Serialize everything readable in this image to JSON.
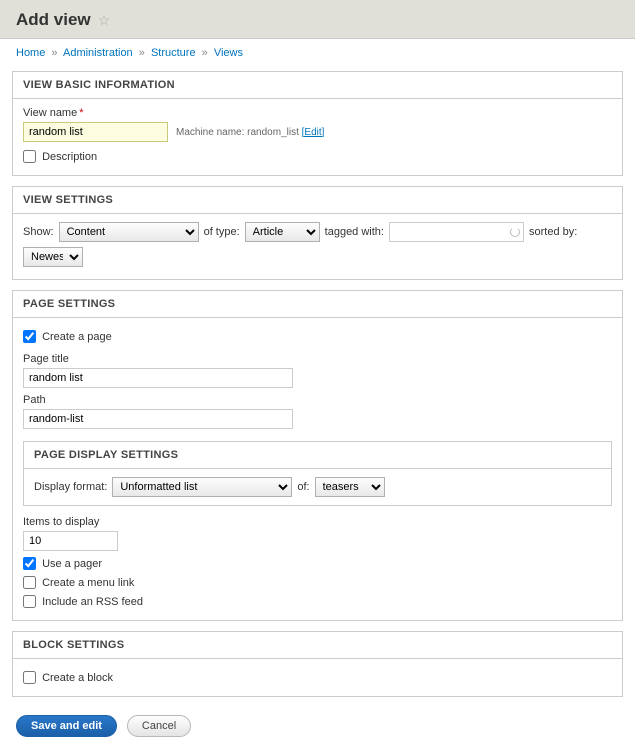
{
  "header": {
    "title": "Add view"
  },
  "breadcrumb": {
    "home": "Home",
    "admin": "Administration",
    "structure": "Structure",
    "views": "Views"
  },
  "basic": {
    "heading": "VIEW BASIC INFORMATION",
    "viewname_label": "View name",
    "viewname_value": "random list",
    "machine_label": "Machine name:",
    "machine_value": "random_list",
    "edit_label": "[Edit]",
    "description_label": "Description"
  },
  "settings": {
    "heading": "VIEW SETTINGS",
    "show_label": "Show:",
    "show_value": "Content",
    "of_type_label": "of type:",
    "of_type_value": "Article",
    "tagged_label": "tagged with:",
    "tagged_value": "",
    "sorted_label": "sorted by:",
    "sorted_value": "Newest first"
  },
  "page": {
    "heading": "PAGE SETTINGS",
    "create_page_label": "Create a page",
    "page_title_label": "Page title",
    "page_title_value": "random list",
    "path_label": "Path",
    "path_value": "random-list",
    "display": {
      "heading": "PAGE DISPLAY SETTINGS",
      "format_label": "Display format:",
      "format_value": "Unformatted list",
      "of_label": "of:",
      "of_value": "teasers"
    },
    "items_label": "Items to display",
    "items_value": "10",
    "pager_label": "Use a pager",
    "menu_label": "Create a menu link",
    "rss_label": "Include an RSS feed"
  },
  "block": {
    "heading": "BLOCK SETTINGS",
    "create_block_label": "Create a block"
  },
  "buttons": {
    "save": "Save and edit",
    "cancel": "Cancel"
  }
}
